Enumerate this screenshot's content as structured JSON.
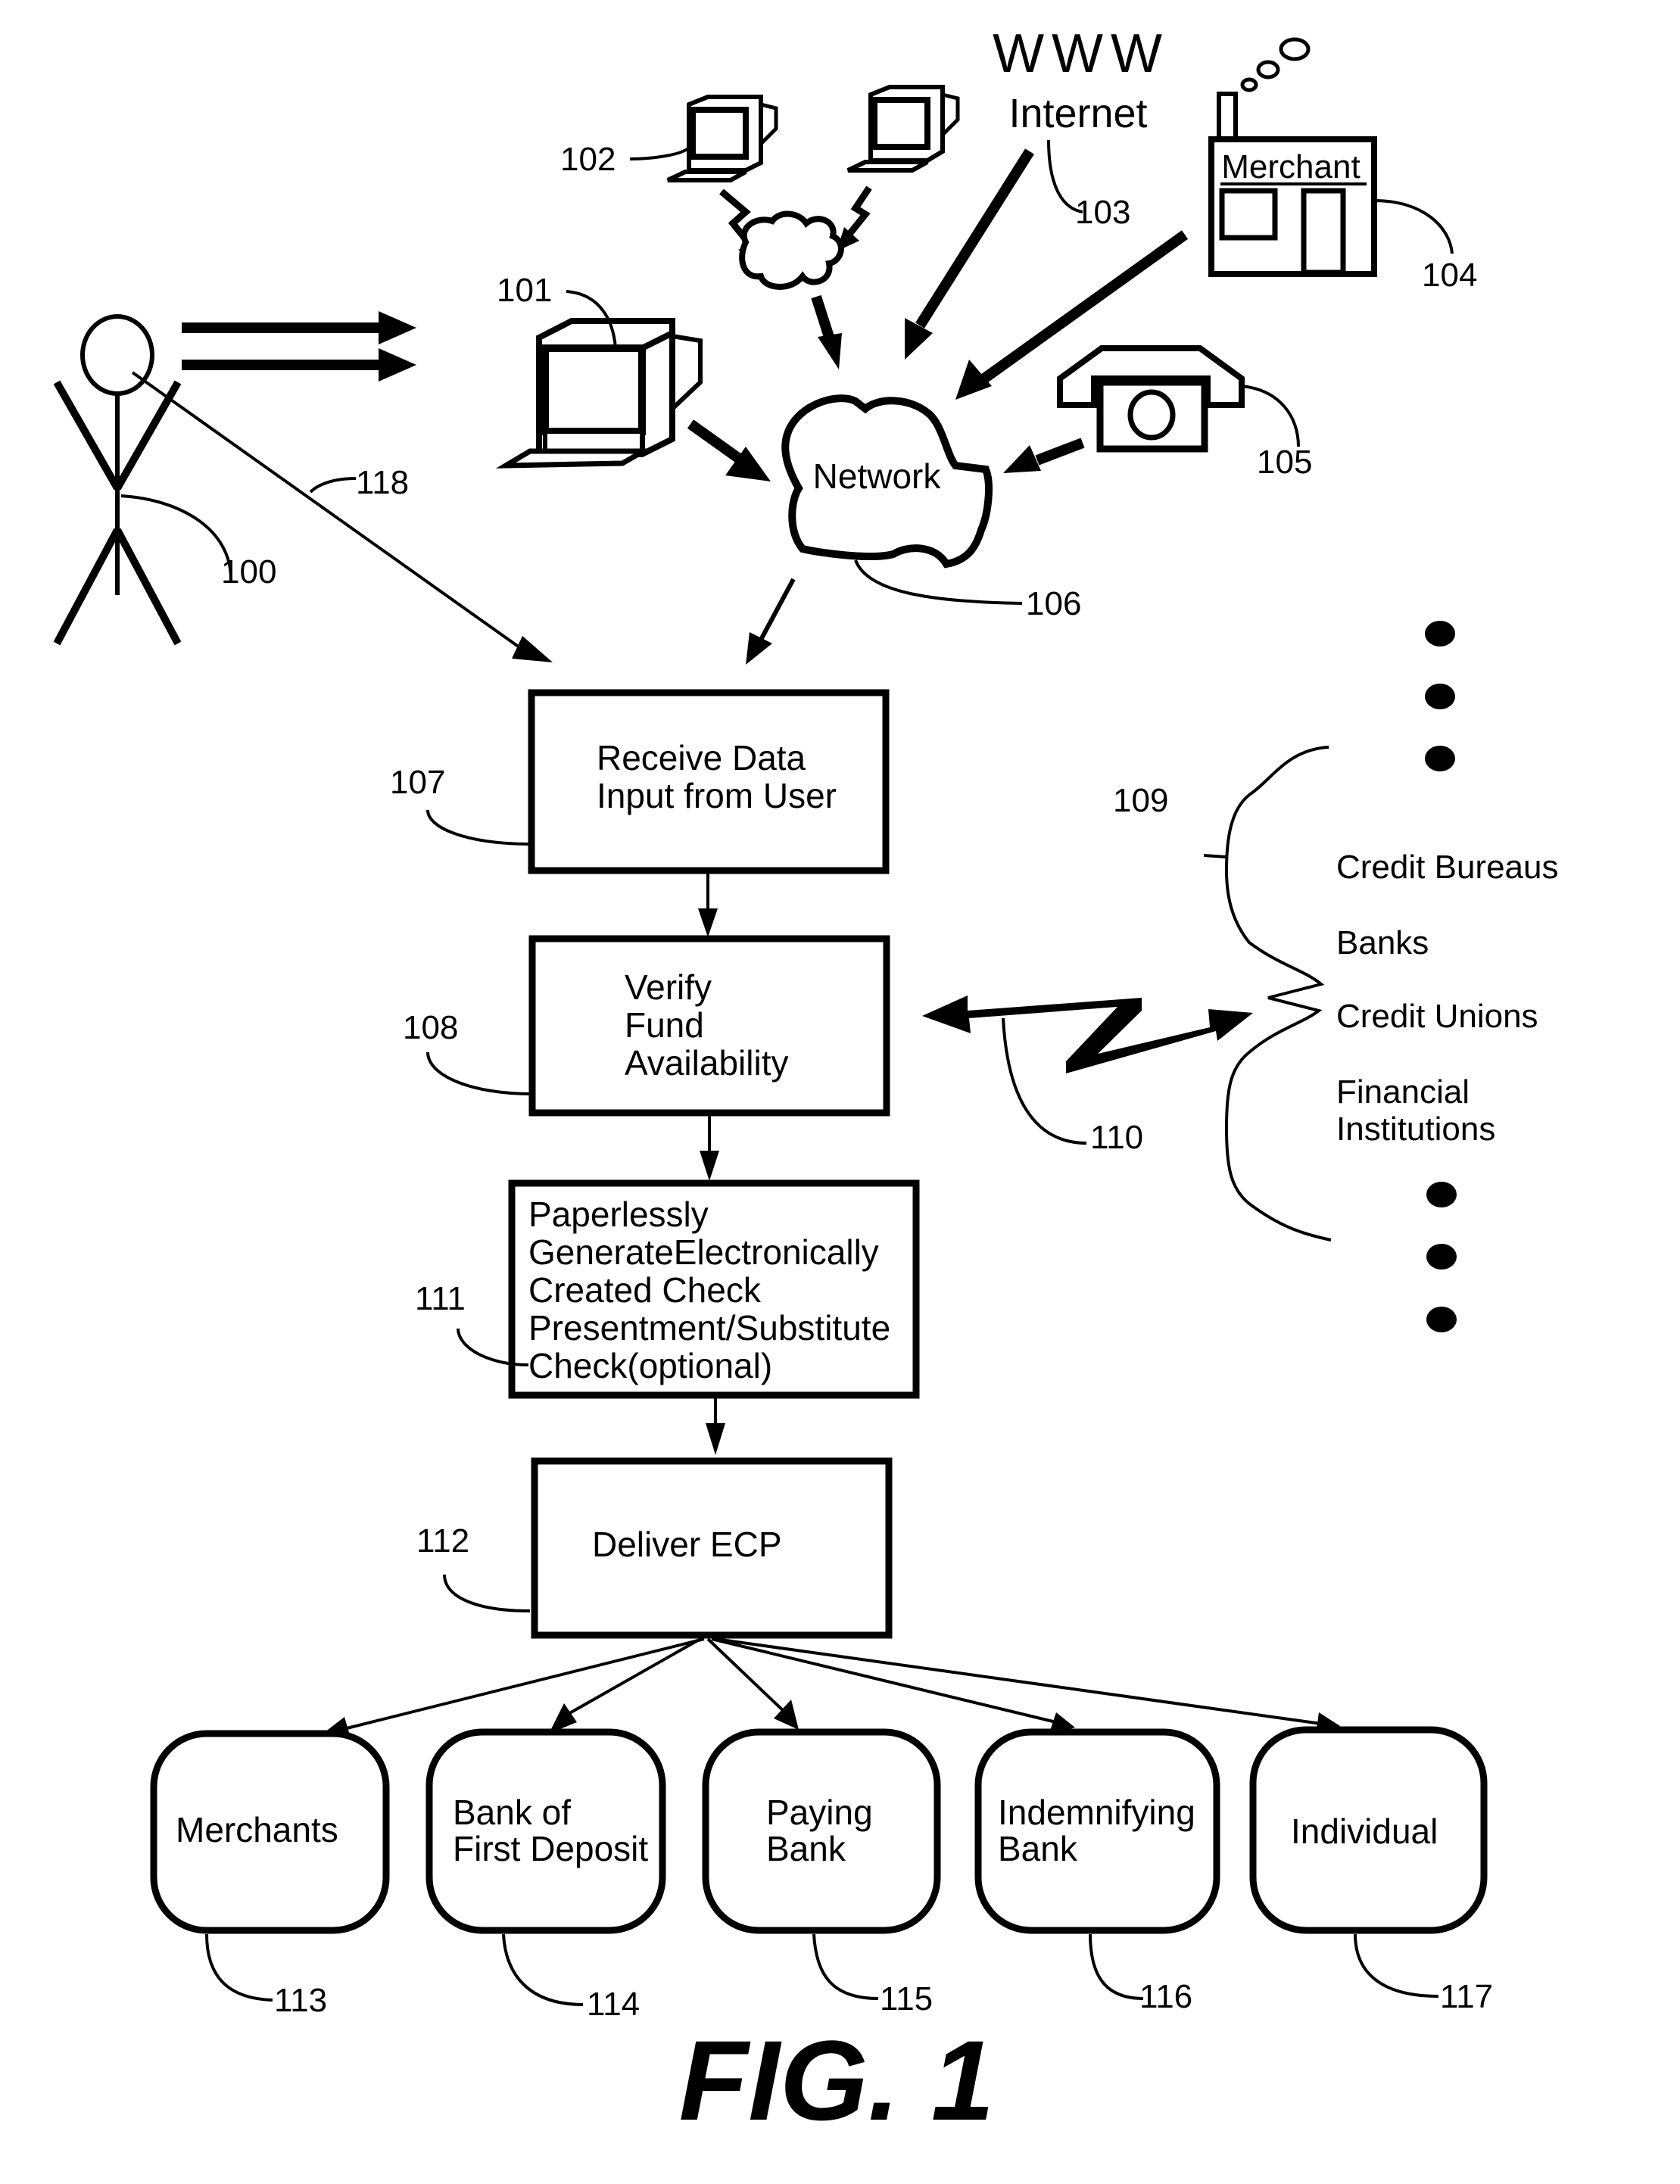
{
  "figure": {
    "title": "FIG. 1"
  },
  "top": {
    "www": "WWW",
    "internet": "Internet",
    "merchant_sign": "Merchant",
    "network": "Network"
  },
  "refs": {
    "user": "100",
    "computer": "101",
    "computers": "102",
    "internet": "103",
    "merchant": "104",
    "phone": "105",
    "network": "106",
    "receive": "107",
    "verify": "108",
    "institutions": "109",
    "link": "110",
    "generate": "111",
    "deliver": "112",
    "line_118": "118"
  },
  "flow": {
    "receive": [
      "Receive Data",
      "Input from User"
    ],
    "verify": [
      "Verify",
      "Fund",
      "Availability"
    ],
    "generate": [
      "Paperlessly",
      "GenerateElectronically",
      "Created Check",
      "Presentment/Substitute",
      "Check(optional)"
    ],
    "deliver": [
      "Deliver ECP"
    ]
  },
  "institutions": {
    "items": [
      "Credit Bureaus",
      "Banks",
      "Credit Unions",
      "Financial",
      "Institutions"
    ]
  },
  "recipients": [
    {
      "ref": "113",
      "lines": [
        "Merchants"
      ]
    },
    {
      "ref": "114",
      "lines": [
        "Bank of",
        "First Deposit"
      ]
    },
    {
      "ref": "115",
      "lines": [
        "Paying",
        "Bank"
      ]
    },
    {
      "ref": "116",
      "lines": [
        "Indemnifying",
        "Bank"
      ]
    },
    {
      "ref": "117",
      "lines": [
        "Individual"
      ]
    }
  ]
}
